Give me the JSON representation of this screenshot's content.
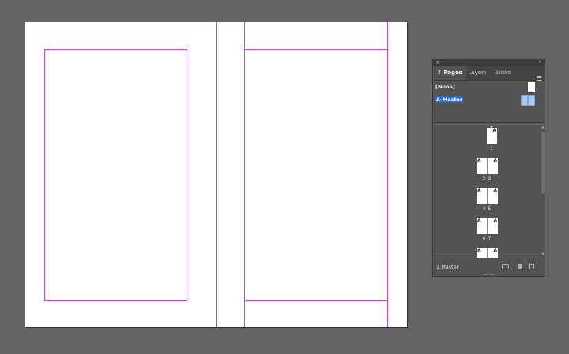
{
  "document": {
    "view": "spread"
  },
  "pages_panel": {
    "tabs": [
      {
        "label": "Pages",
        "active": true,
        "chevron": "↕"
      },
      {
        "label": "Layers",
        "active": false
      },
      {
        "label": "Links",
        "active": false
      }
    ],
    "close_glyph": "×",
    "collapse_glyph": "»",
    "masters": [
      {
        "name": "[None]",
        "selected": false
      },
      {
        "name": "A-Master",
        "selected": true
      }
    ],
    "pages": [
      {
        "label": "1",
        "letters": [
          "A"
        ]
      },
      {
        "label": "2–3",
        "letters": [
          "A",
          "A"
        ]
      },
      {
        "label": "4–5",
        "letters": [
          "A",
          "A"
        ]
      },
      {
        "label": "6–7",
        "letters": [
          "A",
          "A"
        ]
      },
      {
        "label": "",
        "letters": [
          "A",
          "A"
        ]
      }
    ],
    "status_text": "1 Master",
    "icons": [
      "edit-page-size-icon",
      "new-page-icon",
      "delete-page-icon"
    ],
    "colors": {
      "selection": "#2d6bc4",
      "margin_guides": "#c64bd0",
      "pasteboard": "#646464",
      "panel_bg": "#535353"
    }
  }
}
